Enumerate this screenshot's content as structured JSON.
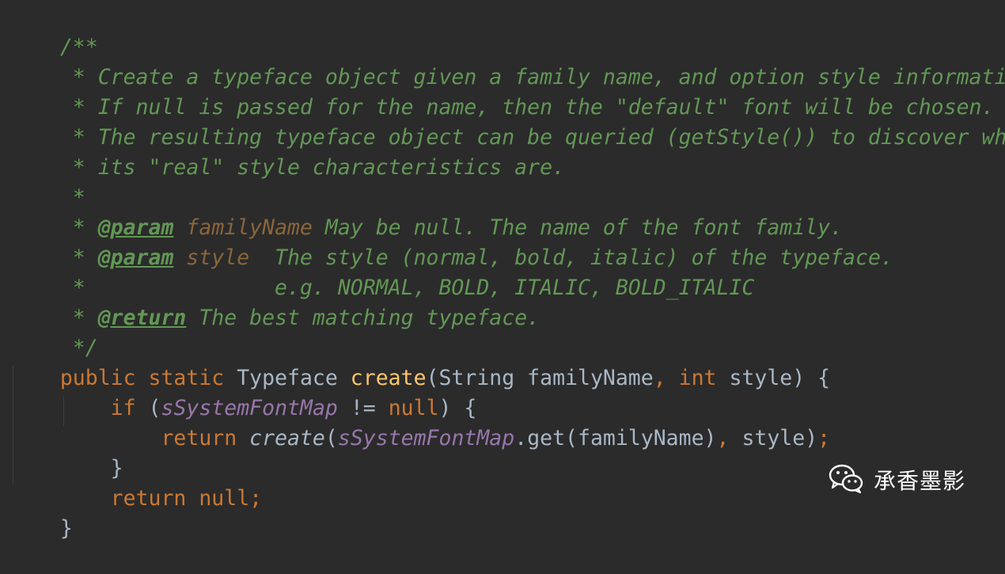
{
  "code": {
    "l1": "/**",
    "l2": " * Create a typeface object given a family name, and option style information.",
    "l3": " * If null is passed for the name, then the \"default\" font will be chosen.",
    "l4": " * The resulting typeface object can be queried (getStyle()) to discover what",
    "l5": " * its \"real\" style characteristics are.",
    "l6": " *",
    "l7_prefix": " * ",
    "l7_tag": "@param",
    "l7_space": " ",
    "l7_param": "familyName",
    "l7_desc": " May be null. The name of the font family.",
    "l8_prefix": " * ",
    "l8_tag": "@param",
    "l8_space": " ",
    "l8_param": "style",
    "l8_desc": "  The style (normal, bold, italic) of the typeface.",
    "l9": " *               e.g. NORMAL, BOLD, ITALIC, BOLD_ITALIC",
    "l10_prefix": " * ",
    "l10_tag": "@return",
    "l10_desc": " The best matching typeface.",
    "l11": " */",
    "l12_kw1": "public static ",
    "l12_type": "Typeface ",
    "l12_fn": "create",
    "l12_args1": "(String familyName",
    "l12_comma": ", ",
    "l12_kw2": "int ",
    "l12_args2": "style) {",
    "l13_indent": "    ",
    "l13_kw": "if ",
    "l13_open": "(",
    "l13_field": "sSystemFontMap",
    "l13_op": " != ",
    "l13_null": "null",
    "l13_close": ") {",
    "l14_indent": "        ",
    "l14_kw": "return ",
    "l14_call": "create",
    "l14_open": "(",
    "l14_field": "sSystemFontMap",
    "l14_get": ".get(familyName)",
    "l14_comma": ", ",
    "l14_rest": "style)",
    "l14_semi": ";",
    "l15": "    }",
    "l16_indent": "    ",
    "l16_kw": "return null",
    "l16_semi": ";",
    "l17": "}"
  },
  "watermark": {
    "text": "承香墨影",
    "icon": "wechat-icon"
  }
}
